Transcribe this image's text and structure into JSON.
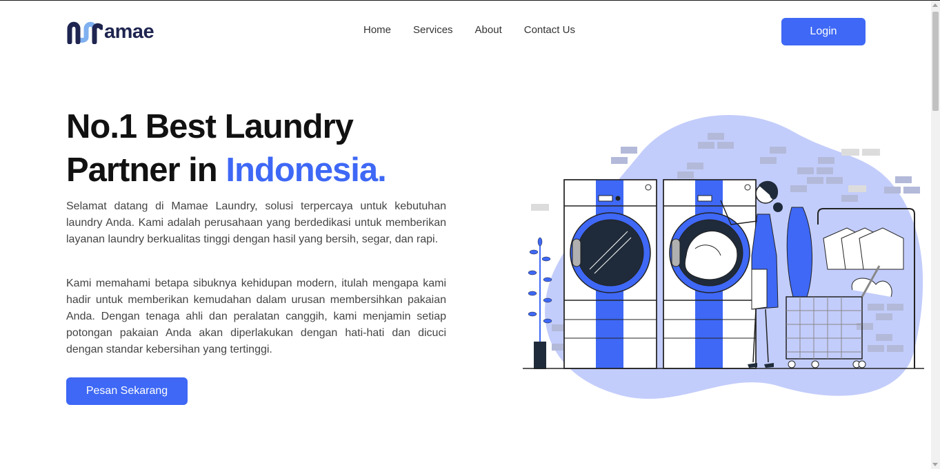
{
  "brand": {
    "name": "amae",
    "colors": {
      "accent": "#3e68f5",
      "dark": "#1f2550",
      "light_blue": "#7fb0f0",
      "blob": "#c3cdfb"
    }
  },
  "nav": {
    "items": [
      {
        "label": "Home"
      },
      {
        "label": "Services"
      },
      {
        "label": "About"
      },
      {
        "label": "Contact Us"
      }
    ],
    "login_label": "Login"
  },
  "hero": {
    "title_line1": "No.1 Best Laundry",
    "title_line2_prefix": "Partner in ",
    "title_line2_accent": "Indonesia.",
    "paragraph1": "Selamat datang di Mamae Laundry, solusi terpercaya untuk kebutuhan laundry Anda. Kami adalah perusahaan yang berdedikasi untuk memberikan layanan laundry berkualitas tinggi dengan hasil yang bersih, segar, dan rapi.",
    "paragraph2": "Kami memahami betapa sibuknya kehidupan modern, itulah mengapa kami hadir untuk memberikan kemudahan dalam urusan membersihkan pakaian Anda. Dengan tenaga ahli dan peralatan canggih, kami menjamin setiap potongan pakaian Anda akan diperlakukan dengan hati-hati dan dicuci dengan standar kebersihan yang tertinggi.",
    "cta_label": "Pesan Sekarang"
  },
  "illustration": {
    "icon": "laundry-illustration"
  }
}
